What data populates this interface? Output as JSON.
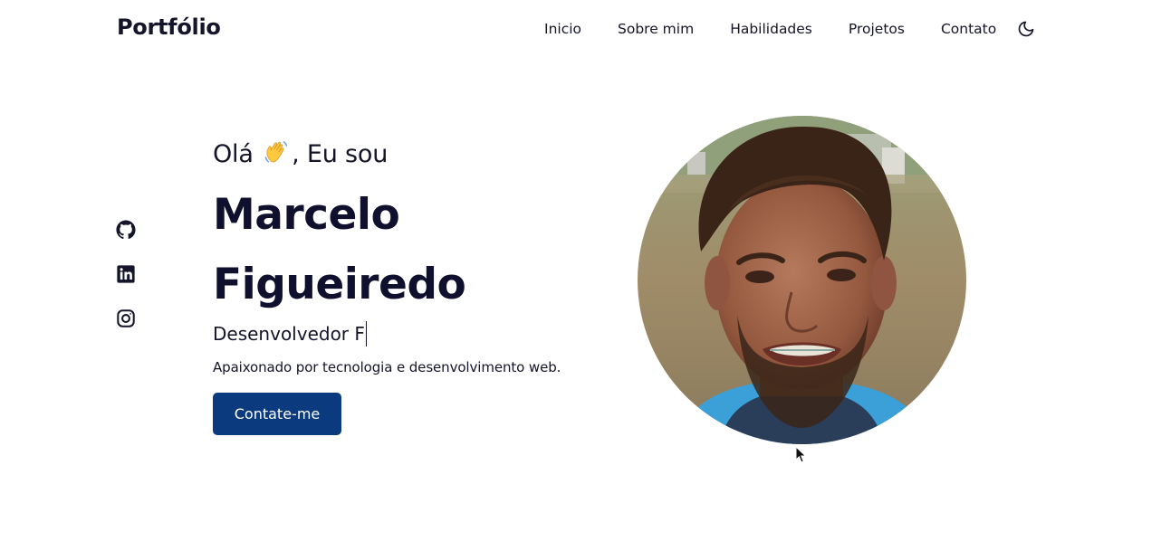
{
  "header": {
    "logo": "Portfólio",
    "nav": [
      "Inicio",
      "Sobre mim",
      "Habilidades",
      "Projetos",
      "Contato"
    ],
    "theme_icon": "moon-icon"
  },
  "social": {
    "icons": [
      "github-icon",
      "linkedin-icon",
      "instagram-icon"
    ]
  },
  "hero": {
    "greeting_pre": "Olá",
    "greeting_emoji": "waving-hand-emoji",
    "greeting_post": ", Eu sou",
    "name_line1": "Marcelo",
    "name_line2": "Figueiredo",
    "role_typed": "Desenvolvedor F",
    "description": "Apaixonado por tecnologia e desenvolvimento web.",
    "button_label": "Contate-me"
  },
  "colors": {
    "text": "#14142b",
    "button": "#0b3a7e",
    "background": "#ffffff"
  }
}
